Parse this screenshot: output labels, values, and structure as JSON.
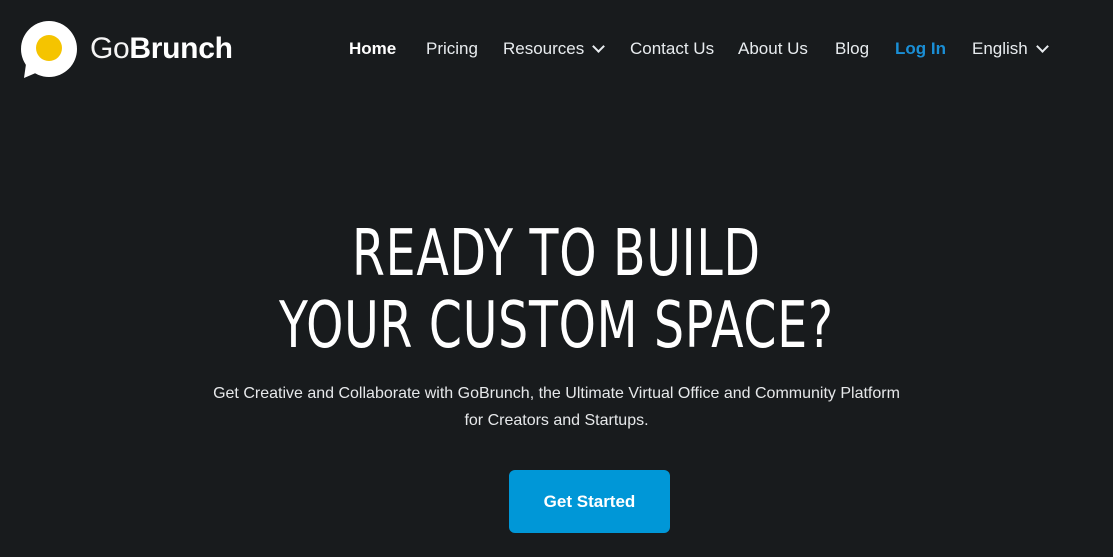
{
  "brand": {
    "name_light": "Go",
    "name_bold": "Brunch",
    "logo_icon": "fried-egg-chat-bubble-icon",
    "yolk_color": "#f5c400"
  },
  "nav": {
    "items": [
      {
        "label": "Home",
        "active": true
      },
      {
        "label": "Pricing"
      },
      {
        "label": "Resources",
        "dropdown": true
      },
      {
        "label": "Contact Us"
      },
      {
        "label": "About Us"
      },
      {
        "label": "Blog"
      },
      {
        "label": "Log In",
        "accent": "#1a8fd6"
      },
      {
        "label": "English",
        "dropdown": true
      }
    ]
  },
  "hero": {
    "title_line1": "READY TO BUILD",
    "title_line2": "YOUR CUSTOM SPACE?",
    "subtitle_line1": "Get Creative and Collaborate with GoBrunch, the Ultimate Virtual Office and Community Platform",
    "subtitle_line2": "for Creators and Startups.",
    "cta_label": "Get Started",
    "cta_color": "#0097d7"
  }
}
